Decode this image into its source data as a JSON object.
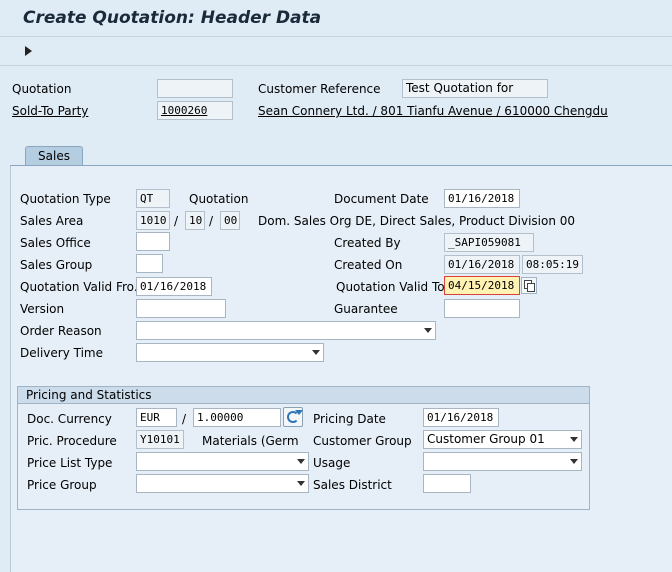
{
  "title": "Create Quotation: Header Data",
  "header": {
    "quotation_label": "Quotation",
    "quotation_value": "",
    "customer_ref_label": "Customer Reference",
    "customer_ref_value": "Test Quotation  for",
    "sold_to_label": "Sold-To Party",
    "sold_to_value": "1000260",
    "sold_to_desc": "Sean Connery Ltd. / 801 Tianfu Avenue / 610000 Chengdu"
  },
  "tabs": [
    {
      "label": "Sales"
    }
  ],
  "sales": {
    "quotation_type_label": "Quotation Type",
    "quotation_type_value": "QT",
    "quotation_type_desc": "Quotation",
    "document_date_label": "Document Date",
    "document_date_value": "01/16/2018",
    "sales_area_label": "Sales Area",
    "sales_org": "1010",
    "dist_channel": "10",
    "division": "00",
    "sep": "/",
    "sales_area_desc": "Dom. Sales Org DE, Direct Sales, Product Division 00",
    "sales_office_label": "Sales Office",
    "sales_office_value": "",
    "created_by_label": "Created By",
    "created_by_value": "_SAPI059081",
    "sales_group_label": "Sales Group",
    "sales_group_value": "",
    "created_on_label": "Created On",
    "created_on_date": "01/16/2018",
    "created_on_time": "08:05:19",
    "valid_from_label": "Quotation Valid Fro...",
    "valid_from_value": "01/16/2018",
    "valid_to_label": "Quotation Valid To",
    "valid_to_value": "04/15/2018",
    "version_label": "Version",
    "version_value": "",
    "guarantee_label": "Guarantee",
    "guarantee_value": "",
    "order_reason_label": "Order Reason",
    "order_reason_value": "",
    "delivery_time_label": "Delivery Time",
    "delivery_time_value": ""
  },
  "pricing": {
    "group_title": "Pricing and Statistics",
    "doc_currency_label": "Doc. Currency",
    "doc_currency_value": "EUR",
    "exchange_sep": "/",
    "exchange_rate": "1.00000",
    "pricing_date_label": "Pricing Date",
    "pricing_date_value": "01/16/2018",
    "pric_procedure_label": "Pric. Procedure",
    "pric_procedure_value": "Y10101",
    "pric_procedure_desc": "Materials (Germ",
    "customer_group_label": "Customer Group",
    "customer_group_value": "Customer Group 01",
    "price_list_type_label": "Price List Type",
    "price_list_type_value": "",
    "usage_label": "Usage",
    "usage_value": "",
    "price_group_label": "Price Group",
    "price_group_value": "",
    "sales_district_label": "Sales District",
    "sales_district_value": ""
  },
  "colors": {
    "background": "#dfebf5",
    "highlight_field": "#fff2b3",
    "highlight_border": "#d9413a"
  }
}
